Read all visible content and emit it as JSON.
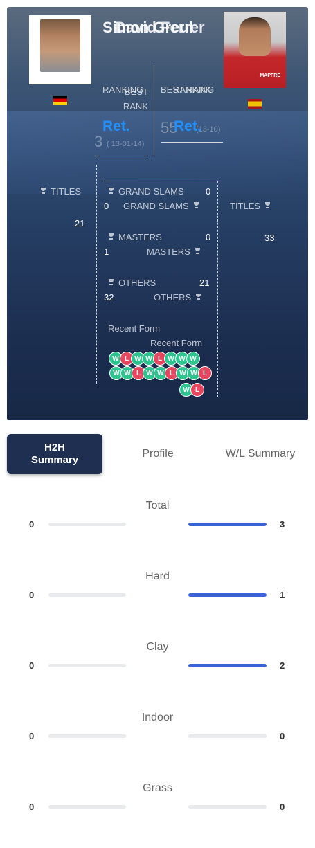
{
  "player1": {
    "name": "Simon Greul",
    "flag": "Germany",
    "rank_label": "RANKING",
    "rank_value": "Ret.",
    "best_rank_label": "BEST RANK",
    "best_rank_value": "3",
    "best_rank_date": "( 13-01-14)",
    "titles_label": "TITLES",
    "titles_value": "21",
    "grand_slams_label": "GRAND SLAMS",
    "grand_slams_value": "0",
    "masters_label": "MASTERS",
    "masters_value": "0",
    "others_label": "OTHERS",
    "others_value": "21",
    "recent_form_label": "Recent Form",
    "recent_form": [
      "W",
      "L",
      "W",
      "W",
      "L",
      "W",
      "W",
      "W"
    ]
  },
  "player2": {
    "name": "David Ferrer",
    "flag": "Spain",
    "rank_label": "RANKING",
    "rank_value": "Ret.",
    "best_rank_label": "BEST RANK",
    "best_rank_value": "55",
    "best_rank_date": "(13-10)",
    "titles_label": "TITLES",
    "titles_value": "33",
    "grand_slams_label": "GRAND SLAMS",
    "grand_slams_value": "0",
    "masters_label": "MASTERS",
    "masters_value": "1",
    "others_label": "OTHERS",
    "others_value": "32",
    "recent_form_label": "Recent Form",
    "recent_form": [
      "W",
      "W",
      "L",
      "W",
      "W",
      "L",
      "W",
      "W",
      "L",
      "W",
      "L"
    ]
  },
  "tabs": {
    "h2h_line1": "H2H",
    "h2h_line2": "Summary",
    "profile": "Profile",
    "wl": "W/L Summary"
  },
  "colors": {
    "accent": "#1e90ff",
    "bar_fill": "#3b63d8",
    "win": "#2ec48f",
    "loss": "#e8455f",
    "tab_active": "#1f2f52"
  },
  "surfaces": [
    {
      "name": "Total",
      "p1": "0",
      "p2": "3",
      "p2_fraction": 1
    },
    {
      "name": "Hard",
      "p1": "0",
      "p2": "1",
      "p2_fraction": 1
    },
    {
      "name": "Clay",
      "p1": "0",
      "p2": "2",
      "p2_fraction": 1
    },
    {
      "name": "Indoor",
      "p1": "0",
      "p2": "0",
      "p2_fraction": 0
    },
    {
      "name": "Grass",
      "p1": "0",
      "p2": "0",
      "p2_fraction": 0
    }
  ]
}
